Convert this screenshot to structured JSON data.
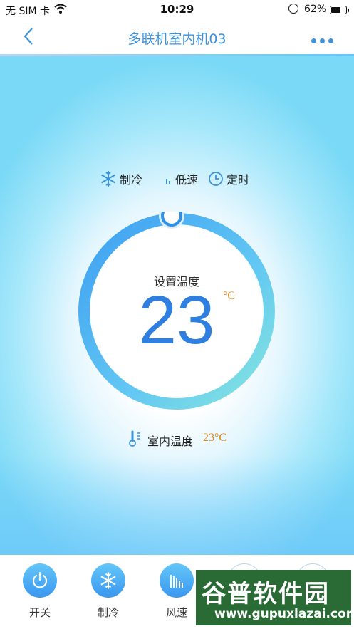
{
  "status": {
    "carrier": "无 SIM 卡",
    "time": "10:29",
    "battery": "62%"
  },
  "nav": {
    "title": "多联机室内机03"
  },
  "modes": {
    "mode_label": "制冷",
    "fan_label": "低速",
    "timer_label": "定时"
  },
  "dial": {
    "label": "设置温度",
    "temperature": "23",
    "unit": "°C"
  },
  "indoor": {
    "label": "室内温度",
    "value": "23°C"
  },
  "bottom": {
    "power": "开关",
    "mode": "制冷",
    "fan": "风速"
  },
  "watermark": {
    "line1": "谷普软件园",
    "line2": "www.gupuxlazai.com"
  },
  "colors": {
    "accent": "#3d92d8",
    "temp": "#2e7fdf",
    "orange": "#d98a1c"
  }
}
